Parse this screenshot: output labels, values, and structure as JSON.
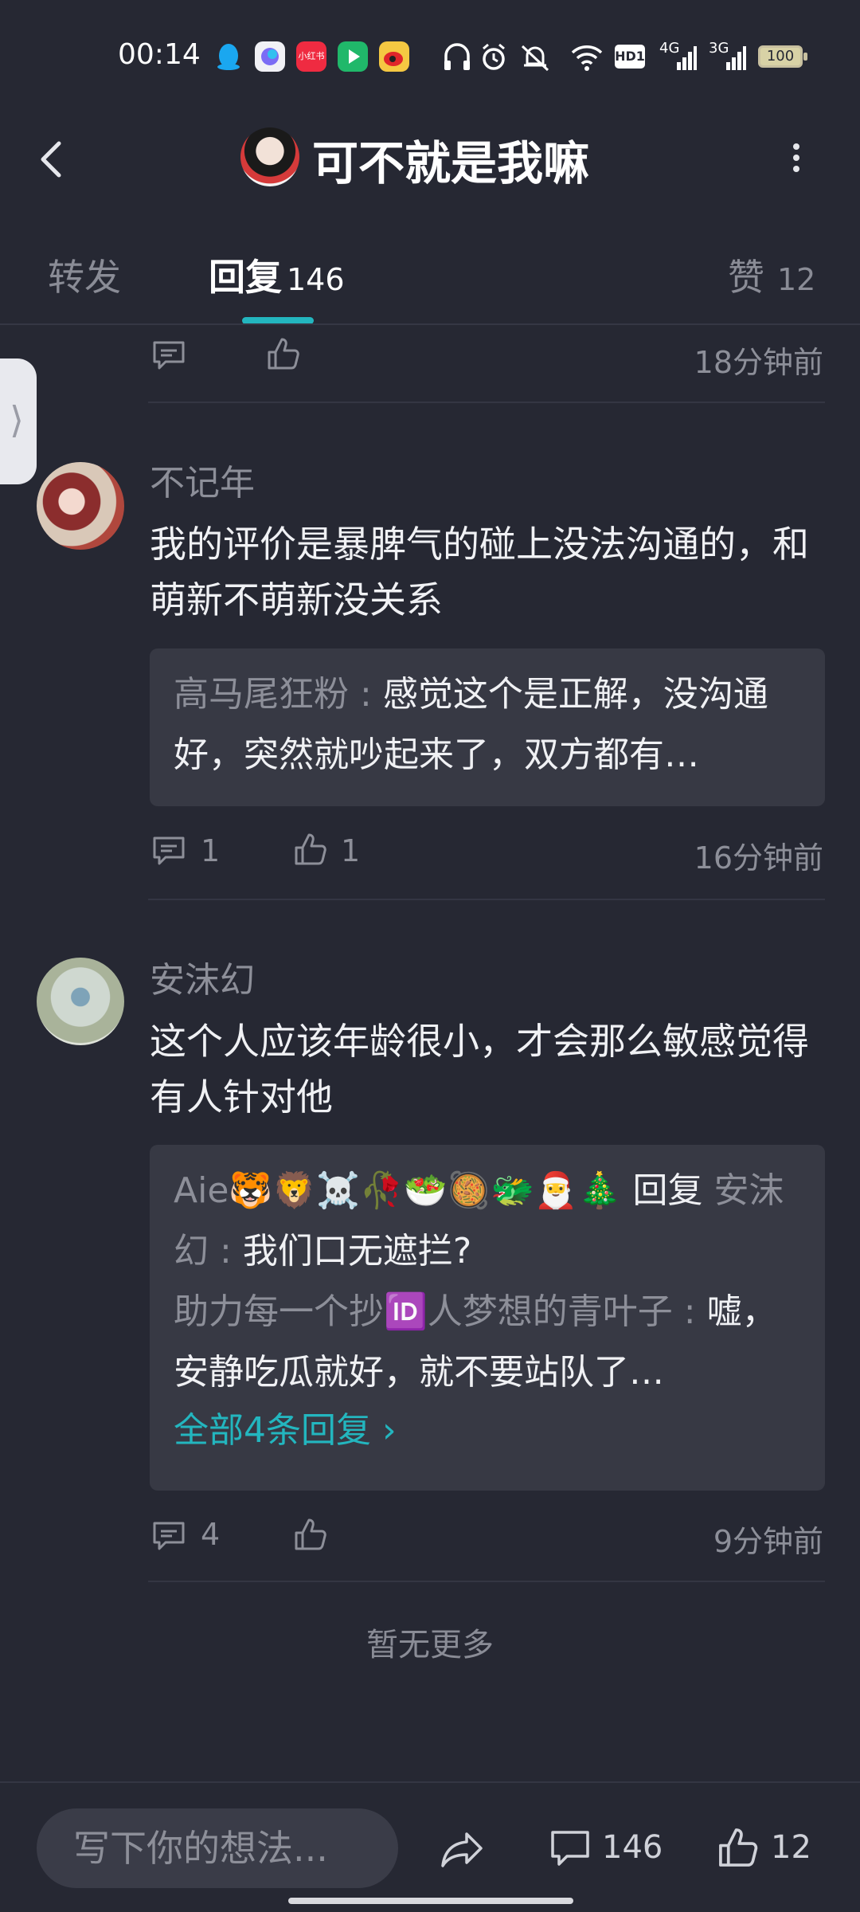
{
  "status": {
    "time": "00:14",
    "apps": [
      "qq",
      "meta-ai",
      "小红书",
      "看剧",
      "weibo"
    ],
    "net1": "4G",
    "net2": "3G",
    "hd": "HD1",
    "battery": "100"
  },
  "header": {
    "title": "可不就是我嘛"
  },
  "tabs": {
    "forward": "转发",
    "reply": "回复",
    "reply_count": "146",
    "like": "赞",
    "like_count": "12"
  },
  "top_partial": {
    "time": "18分钟前"
  },
  "comments": [
    {
      "username": "不记年",
      "content": "我的评价是暴脾气的碰上没法沟通的，和萌新不萌新没关系",
      "reply_name": "高马尾狂粉",
      "reply_sep": ":",
      "reply_text": "感觉这个是正解，没沟通好，突然就吵起来了，双方都有…",
      "comment_count": "1",
      "like_count": "1",
      "time": "16分钟前"
    },
    {
      "username": "安沫幻",
      "content": "这个人应该年龄很小，才会那么敏感觉得有人针对他",
      "reply1_name": "Aie🐯🦁☠️🥀🥗🥘🐲🎅🎄",
      "reply1_word": "回复",
      "reply1_target": "安沫幻",
      "reply1_sep": ":",
      "reply1_text": "我们口无遮拦?",
      "reply2_name": "助力每一个抄🆔人梦想的青叶子",
      "reply2_sep": ":",
      "reply2_text": "嘘，安静吃瓜就好，就不要站队了…",
      "all_replies": "全部4条回复",
      "comment_count": "4",
      "time": "9分钟前"
    }
  ],
  "no_more": "暂无更多",
  "bottom": {
    "placeholder": "写下你的想法...",
    "comment_count": "146",
    "like_count": "12"
  }
}
